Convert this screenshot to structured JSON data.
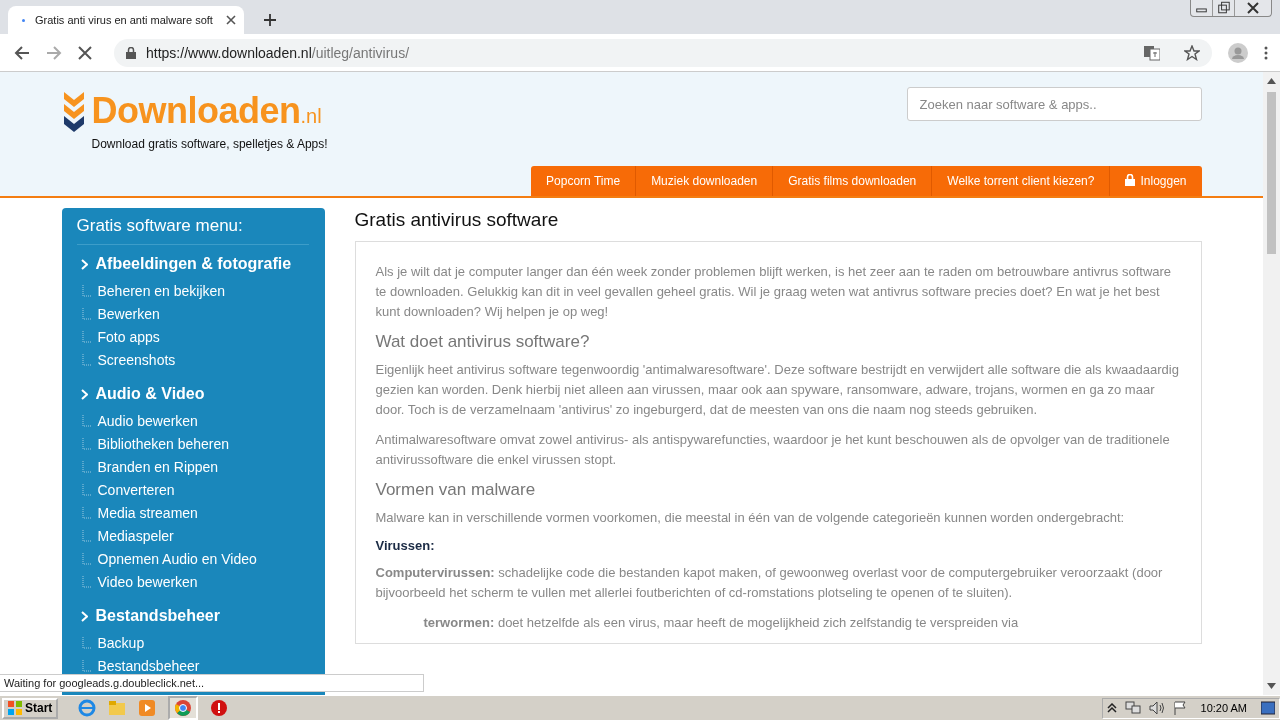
{
  "browser": {
    "tab_title": "Gratis anti virus en anti malware soft",
    "url_host": "https://www.downloaden.nl",
    "url_path": "/uitleg/antivirus/"
  },
  "site": {
    "logo_text": "Downloaden",
    "logo_suffix": ".nl",
    "tagline": "Download gratis software, spelletjes & Apps!",
    "search": {
      "placeholder": "Zoeken naar software & apps.."
    },
    "nav": [
      {
        "label": "Popcorn Time",
        "kind": "link"
      },
      {
        "label": "Muziek downloaden",
        "kind": "link"
      },
      {
        "label": "Gratis films downloaden",
        "kind": "link"
      },
      {
        "label": "Welke torrent client kiezen?",
        "kind": "link"
      },
      {
        "label": "Inloggen",
        "kind": "login"
      }
    ]
  },
  "sidebar": {
    "title": "Gratis software menu:",
    "sections": [
      {
        "label": "Afbeeldingen & fotografie",
        "children": [
          {
            "label": "Beheren en bekijken"
          },
          {
            "label": "Bewerken"
          },
          {
            "label": "Foto apps"
          },
          {
            "label": "Screenshots"
          }
        ]
      },
      {
        "label": "Audio & Video",
        "children": [
          {
            "label": "Audio bewerken"
          },
          {
            "label": "Bibliotheken beheren"
          },
          {
            "label": "Branden en Rippen"
          },
          {
            "label": "Converteren"
          },
          {
            "label": "Media streamen"
          },
          {
            "label": "Mediaspeler"
          },
          {
            "label": "Opnemen Audio en Video"
          },
          {
            "label": "Video bewerken"
          }
        ]
      },
      {
        "label": "Bestandsbeheer",
        "children": [
          {
            "label": "Backup"
          },
          {
            "label": "Bestandsbeheer"
          }
        ]
      }
    ]
  },
  "article": {
    "title": "Gratis antivirus software",
    "blocks": [
      {
        "kind": "p",
        "text": "Als je wilt dat je computer langer dan één week zonder problemen blijft werken, is het zeer aan te raden om betrouwbare antivrus software te downloaden. Gelukkig kan dit in veel gevallen geheel gratis. Wil je graag weten wat antivrus software precies doet? En wat je het best kunt downloaden? Wij helpen je op weg!"
      },
      {
        "kind": "h",
        "text": "Wat doet antivirus software?"
      },
      {
        "kind": "p",
        "text": "Eigenlijk heet antivirus software tegenwoordig 'antimalwaresoftware'. Deze software bestrijdt en verwijdert alle software die als kwaadaardig gezien kan worden. Denk hierbij niet alleen aan virussen, maar ook aan spyware, ransomware, adware, trojans, wormen en ga zo maar door. Toch is de verzamelnaam 'antivirus' zo ingeburgerd, dat de meesten van ons die naam nog steeds gebruiken."
      },
      {
        "kind": "p",
        "text": "Antimalwaresoftware omvat zowel antivirus- als antispywarefuncties, waardoor je het kunt beschouwen als de opvolger van de traditionele antivirussoftware die enkel virussen stopt."
      },
      {
        "kind": "h",
        "text": "Vormen van malware"
      },
      {
        "kind": "p",
        "text": "Malware kan in verschillende vormen voorkomen, die meestal in één van de volgende categorieën kunnen worden ondergebracht:"
      },
      {
        "kind": "label",
        "text": "Virussen:"
      },
      {
        "kind": "p",
        "text": "**Computervirussen:** schadelijke code die bestanden kapot maken, of gewoonweg overlast voor de computergebruiker veroorzaakt (door bijvoorbeeld het scherm te vullen met allerlei foutberichten of cd-romstations plotseling te openen of te sluiten)."
      },
      {
        "kind": "covered",
        "text": "**terwormen:** doet hetzelfde als een virus, maar heeft de mogelijkheid zich zelfstandig te verspreiden via"
      }
    ]
  },
  "status_bubble": "Waiting for googleads.g.doubleclick.net...",
  "taskbar": {
    "start": "Start",
    "clock": "10:20 AM"
  }
}
